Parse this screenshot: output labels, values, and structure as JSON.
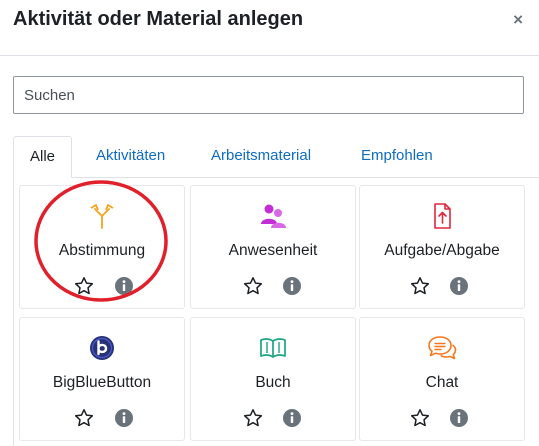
{
  "dialog": {
    "title": "Aktivität oder Material anlegen",
    "close_symbol": "×"
  },
  "search": {
    "placeholder": "Suchen",
    "value": ""
  },
  "tabs": [
    {
      "label": "Alle",
      "active": true
    },
    {
      "label": "Aktivitäten",
      "active": false
    },
    {
      "label": "Arbeitsmaterial",
      "active": false
    },
    {
      "label": "Empfohlen",
      "active": false
    }
  ],
  "modules": [
    {
      "label": "Abstimmung",
      "icon": "choice-icon",
      "icon_color": "#f7a31d"
    },
    {
      "label": "Anwesenheit",
      "icon": "attendance-icon",
      "icon_color": "#c42dd6"
    },
    {
      "label": "Aufgabe/Abgabe",
      "icon": "assignment-icon",
      "icon_color": "#e0273d"
    },
    {
      "label": "BigBlueButton",
      "icon": "bigbluebutton-icon",
      "icon_color": "#283274"
    },
    {
      "label": "Buch",
      "icon": "book-icon",
      "icon_color": "#1aa583"
    },
    {
      "label": "Chat",
      "icon": "chat-icon",
      "icon_color": "#f7781d"
    }
  ],
  "annotation": {
    "shape": "red-circle",
    "target": "Abstimmung",
    "color": "#e0202a"
  },
  "colors": {
    "link": "#0f6cbf",
    "info_badge": "#6a737b",
    "text": "#1d2125"
  }
}
